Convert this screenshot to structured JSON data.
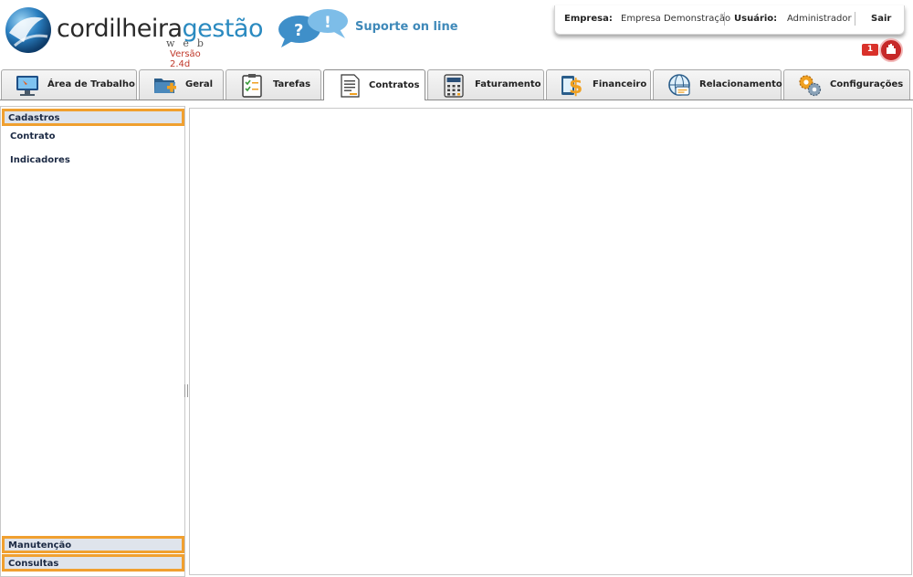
{
  "header": {
    "logo_part1": "cordilheira",
    "logo_part2": "gestão",
    "logo_web": "web",
    "version": "Versão 2.4d",
    "support_label": "Suporte on line"
  },
  "infobar": {
    "company_label": "Empresa:",
    "company_value": "Empresa Demonstração",
    "user_label": "Usuário:",
    "user_value": "Administrador",
    "logout_label": "Sair"
  },
  "notifications": {
    "count": "1"
  },
  "tabs": [
    {
      "label": "Área de Trabalho",
      "icon": "monitor-icon"
    },
    {
      "label": "Geral",
      "icon": "folder-add-icon"
    },
    {
      "label": "Tarefas",
      "icon": "checklist-icon"
    },
    {
      "label": "Contratos",
      "icon": "document-icon",
      "active": true
    },
    {
      "label": "Faturamento",
      "icon": "calculator-icon"
    },
    {
      "label": "Financeiro",
      "icon": "money-icon"
    },
    {
      "label": "Relacionamento",
      "icon": "chat-globe-icon"
    },
    {
      "label": "Configurações",
      "icon": "gears-icon"
    }
  ],
  "sidebar": {
    "sections": [
      {
        "label": "Cadastros",
        "items": [
          "Contrato",
          "Indicadores"
        ]
      },
      {
        "label": "Manutenção"
      },
      {
        "label": "Consultas"
      }
    ]
  },
  "colors": {
    "accent_blue": "#2a8ac0",
    "section_highlight": "#f0a030",
    "section_bg": "#dfe4ec",
    "alert_red": "#d9312a"
  }
}
